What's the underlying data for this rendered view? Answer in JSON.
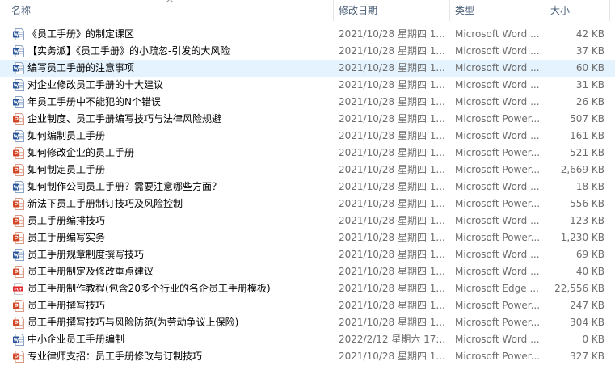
{
  "columns": {
    "name": "名称",
    "date": "修改日期",
    "type": "类型",
    "size": "大小"
  },
  "colors": {
    "word": "#2b579a",
    "powerpoint": "#d24726",
    "pdf": "#e1252a",
    "selected": "#e5f3ff",
    "header_text": "#4c607a"
  },
  "files": [
    {
      "name": "《员工手册》的制定课区",
      "date": "2021/10/28 星期四 1...",
      "type": "Microsoft Word ...",
      "size": "42 KB",
      "icon": "word-doc-icon"
    },
    {
      "name": "【实务派】《员工手册》的小疏忽-引发的大风险",
      "date": "2021/10/28 星期四 1...",
      "type": "Microsoft Word ...",
      "size": "37 KB",
      "icon": "word-doc-icon"
    },
    {
      "name": "编写员工手册的注意事项",
      "date": "2021/10/28 星期四 1...",
      "type": "Microsoft Word ...",
      "size": "60 KB",
      "icon": "word-doc-icon",
      "selected": true
    },
    {
      "name": "对企业修改员工手册的十大建议",
      "date": "2021/10/28 星期四 1...",
      "type": "Microsoft Word ...",
      "size": "31 KB",
      "icon": "word-doc-icon"
    },
    {
      "name": "年员工手册中不能犯的N个错误",
      "date": "2021/10/28 星期四 1...",
      "type": "Microsoft Word ...",
      "size": "26 KB",
      "icon": "word-doc-icon"
    },
    {
      "name": "企业制度、员工手册编写技巧与法律风险规避",
      "date": "2021/10/28 星期四 1...",
      "type": "Microsoft Power...",
      "size": "507 KB",
      "icon": "powerpoint-icon"
    },
    {
      "name": "如何编制员工手册",
      "date": "2021/10/28 星期四 1...",
      "type": "Microsoft Word ...",
      "size": "161 KB",
      "icon": "word-doc-icon"
    },
    {
      "name": "如何修改企业的员工手册",
      "date": "2021/10/28 星期四 1...",
      "type": "Microsoft Power...",
      "size": "521 KB",
      "icon": "powerpoint-icon"
    },
    {
      "name": "如何制定员工手册",
      "date": "2021/10/28 星期四 1...",
      "type": "Microsoft Power...",
      "size": "2,669 KB",
      "icon": "powerpoint-icon"
    },
    {
      "name": "如何制作公司员工手册？需要注意哪些方面？",
      "date": "2021/10/28 星期四 1...",
      "type": "Microsoft Word ...",
      "size": "18 KB",
      "icon": "word-doc-icon"
    },
    {
      "name": "新法下员工手册制订技巧及风险控制",
      "date": "2021/10/28 星期四 1...",
      "type": "Microsoft Power...",
      "size": "556 KB",
      "icon": "powerpoint-icon"
    },
    {
      "name": "员工手册编排技巧",
      "date": "2021/10/28 星期四 1...",
      "type": "Microsoft Word ...",
      "size": "123 KB",
      "icon": "powerpoint-icon"
    },
    {
      "name": "员工手册编写实务",
      "date": "2021/10/28 星期四 1...",
      "type": "Microsoft Power...",
      "size": "1,230 KB",
      "icon": "powerpoint-icon"
    },
    {
      "name": "员工手册规章制度撰写技巧",
      "date": "2021/10/28 星期四 1...",
      "type": "Microsoft Word ...",
      "size": "69 KB",
      "icon": "word-doc-icon"
    },
    {
      "name": "员工手册制定及修改重点建议",
      "date": "2021/10/28 星期四 1...",
      "type": "Microsoft Word ...",
      "size": "40 KB",
      "icon": "powerpoint-icon"
    },
    {
      "name": "员工手册制作教程(包含20多个行业的名企员工手册模板)",
      "date": "2021/10/28 星期四 1...",
      "type": "Microsoft Edge ...",
      "size": "22,556 KB",
      "icon": "pdf-icon"
    },
    {
      "name": "员工手册撰写技巧",
      "date": "2021/10/28 星期四 1...",
      "type": "Microsoft Power...",
      "size": "247 KB",
      "icon": "powerpoint-icon"
    },
    {
      "name": "员工手册撰写技巧与风险防范(为劳动争议上保险)",
      "date": "2021/10/28 星期四 1...",
      "type": "Microsoft Power...",
      "size": "304 KB",
      "icon": "powerpoint-icon"
    },
    {
      "name": "中小企业员工手册编制",
      "date": "2022/2/12 星期六 17:...",
      "type": "Microsoft Word ...",
      "size": "0 KB",
      "icon": "word-doc-icon"
    },
    {
      "name": "专业律师支招：员工手册修改与订制技巧",
      "date": "2021/10/28 星期四 1...",
      "type": "Microsoft Power...",
      "size": "327 KB",
      "icon": "powerpoint-icon"
    }
  ]
}
